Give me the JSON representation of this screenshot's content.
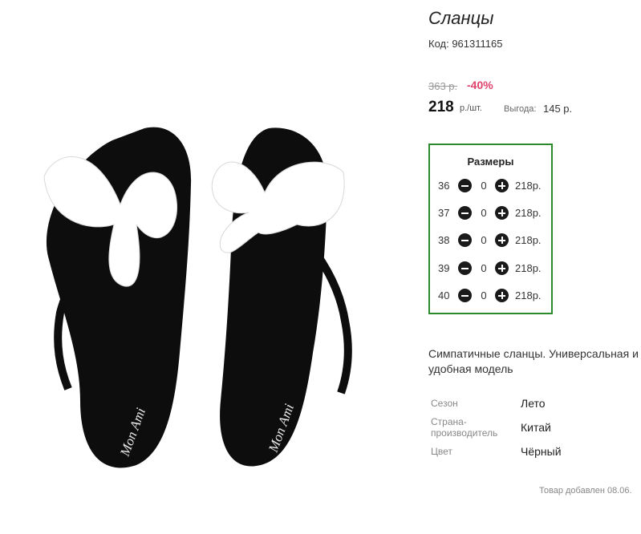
{
  "product": {
    "title": "Сланцы",
    "code": "Код: 961311165",
    "image_alt": "black jelly flip-flops with white bows",
    "brand_imprint": "Mon Ami"
  },
  "pricing": {
    "old_price": "363 р.",
    "discount": "-40%",
    "price": "218",
    "unit": "р./шт.",
    "benefit_label": "Выгода:",
    "benefit_value": "145 р."
  },
  "sizes": {
    "title": "Размеры",
    "rows": [
      {
        "size": "36",
        "qty": "0",
        "price": "218р."
      },
      {
        "size": "37",
        "qty": "0",
        "price": "218р."
      },
      {
        "size": "38",
        "qty": "0",
        "price": "218р."
      },
      {
        "size": "39",
        "qty": "0",
        "price": "218р."
      },
      {
        "size": "40",
        "qty": "0",
        "price": "218р."
      }
    ]
  },
  "description": {
    "line1": "Симпатичные сланцы. Универсальная и",
    "line2": "удобная модель"
  },
  "attributes": [
    {
      "label": "Сезон",
      "label2": "",
      "value": "Лето"
    },
    {
      "label": "Страна-",
      "label2": "производитель",
      "value": "Китай"
    },
    {
      "label": "Цвет",
      "label2": "",
      "value": "Чёрный"
    }
  ],
  "added_text": "Товар добавлен 08.06.",
  "colors": {
    "accent_border": "#2b8a2b",
    "discount": "#e0416b",
    "sandal": "#0d0d0d",
    "bow": "#ffffff"
  }
}
